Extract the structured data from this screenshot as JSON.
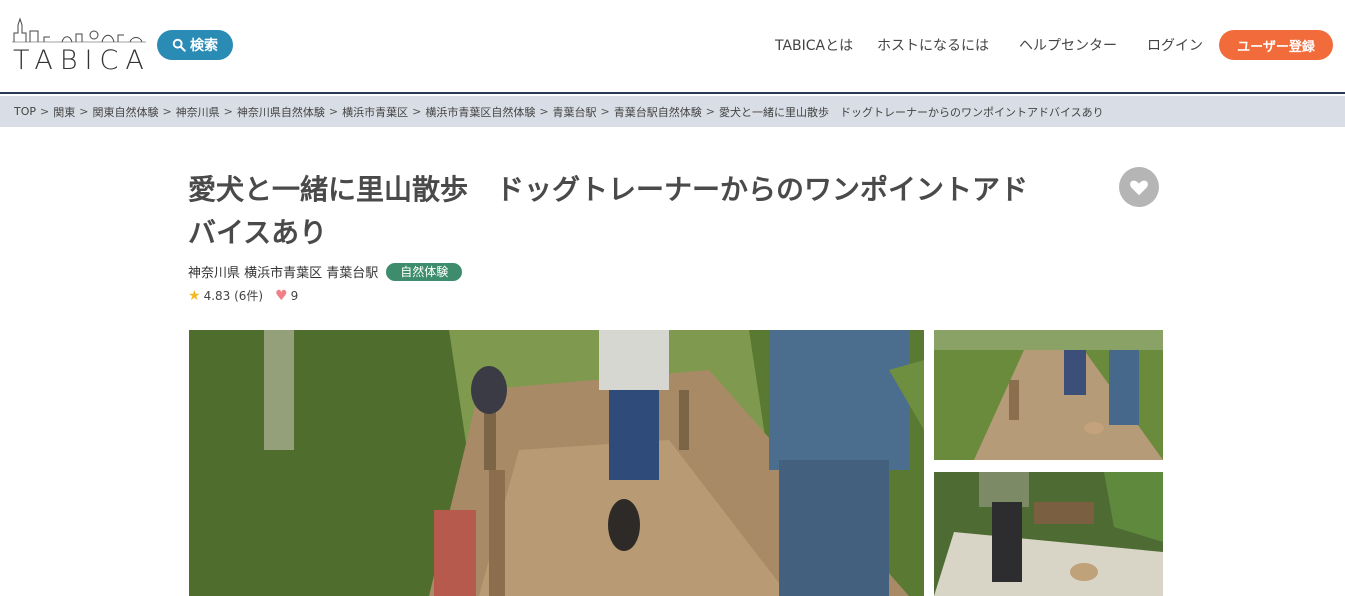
{
  "header": {
    "logo_text": "TABICA",
    "search_label": "検索",
    "nav": [
      "TABICAとは",
      "ホストになるには",
      "ヘルプセンター",
      "ログイン"
    ],
    "signup_label": "ユーザー登録"
  },
  "breadcrumb": [
    "TOP",
    "関東",
    "関東自然体験",
    "神奈川県",
    "神奈川県自然体験",
    "横浜市青葉区",
    "横浜市青葉区自然体験",
    "青葉台駅",
    "青葉台駅自然体験",
    "愛犬と一緒に里山散歩　ドッグトレーナーからのワンポイントアドバイスあり"
  ],
  "experience": {
    "title_line1": "愛犬と一緒に里山散歩　ドッグトレーナーからのワンポイントアド",
    "title_line2": "バイスあり",
    "location": "神奈川県 横浜市青葉区 青葉台駅",
    "category": "自然体験",
    "rating": "4.83",
    "review_count": "(6件)",
    "favorites": "9"
  },
  "colors": {
    "brand_blue": "#2a8bb5",
    "signup_orange": "#f26b3a",
    "badge_green": "#3e8c6e",
    "star": "#f5b921",
    "heart": "#f07f86"
  }
}
